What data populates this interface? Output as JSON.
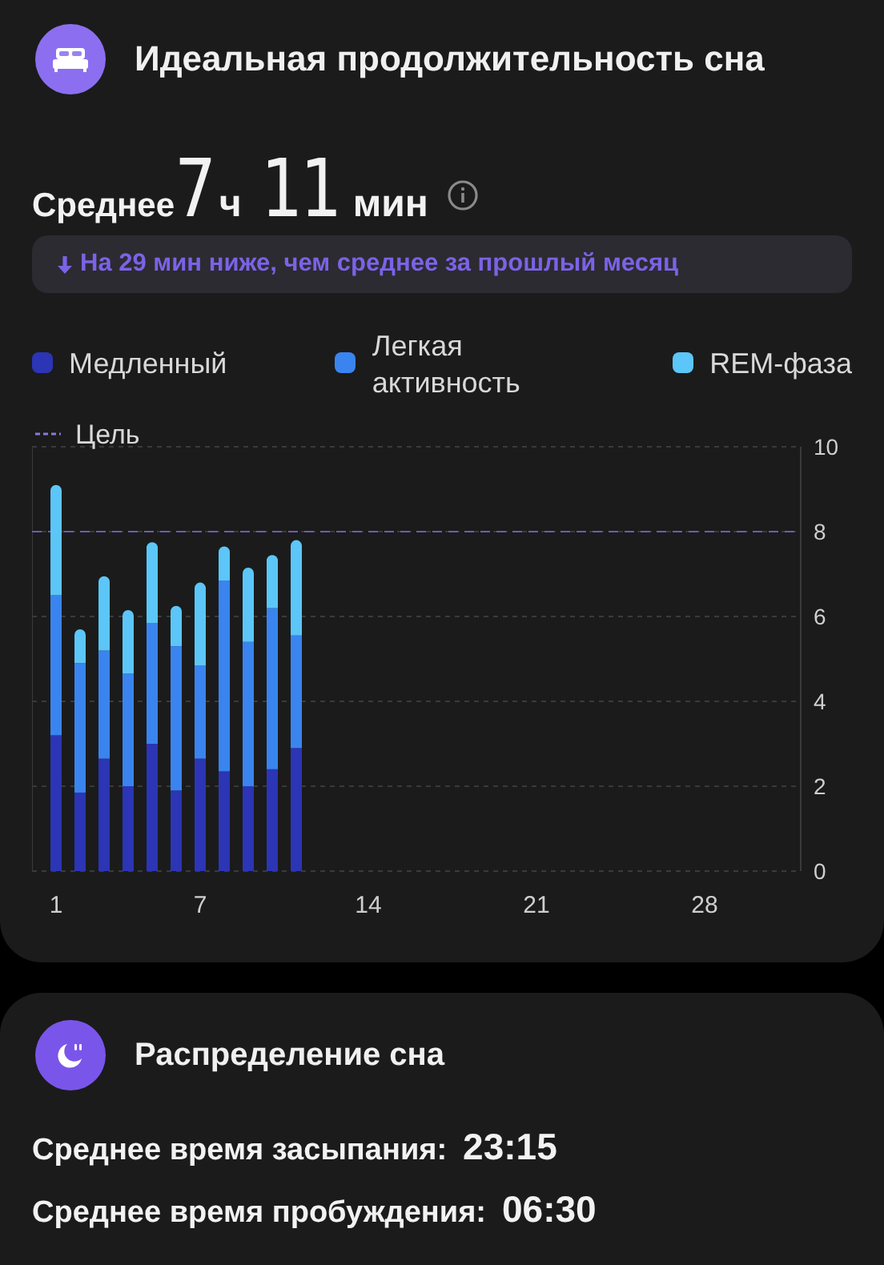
{
  "sleep_duration": {
    "title": "Идеальная продолжительность сна",
    "average": {
      "label": "Среднее",
      "hours": "7",
      "hours_unit": "ч",
      "minutes": "11",
      "minutes_unit": "мин"
    },
    "comparison": {
      "text": "На 29 мин ниже, чем среднее за прошлый месяц"
    },
    "chart_data": {
      "type": "bar",
      "stacked": true,
      "grid": true,
      "x": [
        1,
        2,
        3,
        4,
        5,
        6,
        7,
        8,
        9,
        10,
        11
      ],
      "series": [
        {
          "name": "Медленный",
          "color": "#2b35b5",
          "values": [
            3.2,
            1.85,
            2.65,
            2.0,
            3.0,
            1.9,
            2.65,
            2.35,
            2.0,
            2.4,
            2.9
          ]
        },
        {
          "name": "Легкая активность",
          "color": "#3a84ef",
          "values": [
            3.3,
            3.05,
            2.55,
            2.65,
            2.85,
            3.4,
            2.2,
            4.5,
            3.4,
            3.8,
            2.65
          ]
        },
        {
          "name": "REM-фаза",
          "color": "#5cc6f8",
          "values": [
            2.6,
            0.8,
            1.75,
            1.5,
            1.9,
            0.95,
            1.95,
            0.8,
            1.75,
            1.25,
            2.25
          ]
        }
      ],
      "xlim": [
        0,
        32
      ],
      "xticks": [
        1,
        7,
        14,
        21,
        28
      ],
      "ylim": [
        0,
        10
      ],
      "yticks": [
        0,
        2,
        4,
        6,
        8,
        10
      ],
      "ref_lines": [
        {
          "value": 8,
          "axis": "y",
          "label": "Цель"
        }
      ]
    }
  },
  "sleep_schedule": {
    "title": "Распределение сна",
    "rows": [
      {
        "label": "Среднее время засыпания:",
        "value": "23:15"
      },
      {
        "label": "Среднее время пробуждения:",
        "value": "06:30"
      }
    ]
  }
}
